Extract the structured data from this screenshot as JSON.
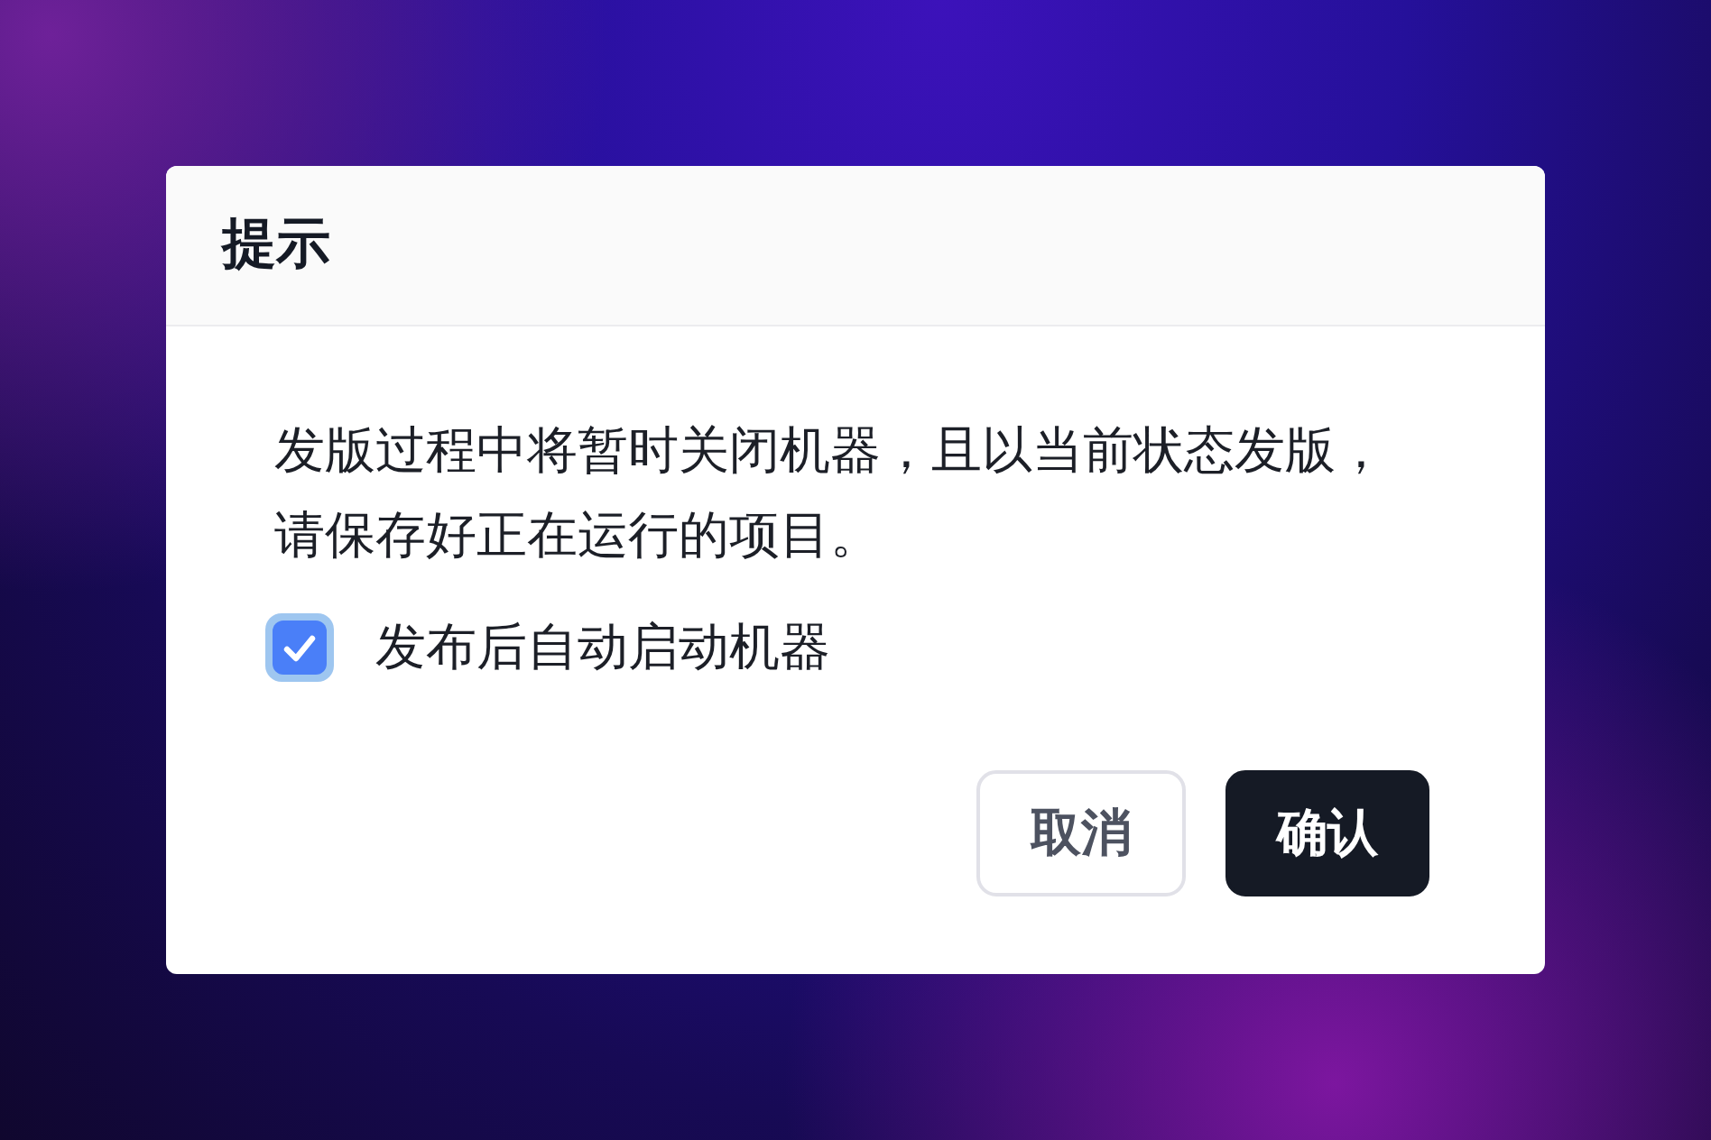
{
  "dialog": {
    "title": "提示",
    "message_lines": [
      "发版过程中将暂时关闭机器，且以当前状态发版，",
      "请保存好正在运行的项目。"
    ],
    "checkbox": {
      "label": "发布后自动启动机器",
      "checked": true
    },
    "buttons": [
      {
        "label": "取消",
        "kind": "secondary"
      },
      {
        "label": "确认",
        "kind": "primary"
      }
    ]
  }
}
